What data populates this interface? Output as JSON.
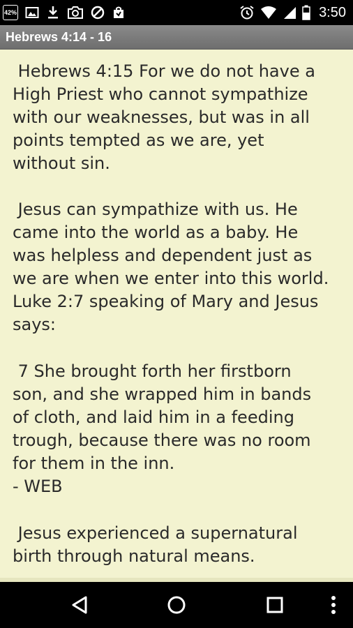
{
  "status_bar": {
    "battery_percent_icon_text": "42%",
    "time": "3:50",
    "left_icons": [
      "battery-percent-icon",
      "image-icon",
      "download-icon",
      "camera-icon",
      "block-icon",
      "store-icon"
    ],
    "right_icons": [
      "alarm-icon",
      "wifi-icon",
      "signal-icon",
      "battery-icon"
    ]
  },
  "header": {
    "title": "Hebrews 4:14 - 16"
  },
  "content": {
    "paragraphs": [
      " Hebrews 4:15 For we do not have a\nHigh Priest who cannot sympathize\nwith our weaknesses, but was in all\npoints tempted as we are, yet\nwithout sin.",
      " Jesus can sympathize with us. He\ncame into the world as a baby. He\nwas helpless and dependent just as\nwe are when we enter into this world.\nLuke 2:7 speaking of Mary and Jesus\nsays:",
      " 7 She brought forth her firstborn\nson, and she wrapped him in bands\nof cloth, and laid him in a feeding\ntrough, because there was no room\nfor them in the inn.\n- WEB",
      " Jesus experienced a supernatural\nbirth through natural means."
    ]
  },
  "nav_bar": {
    "buttons": [
      "back-icon",
      "home-icon",
      "recents-icon",
      "overflow-menu-icon"
    ]
  },
  "colors": {
    "content_background": "#f3f3d0",
    "title_bar": "#7d7d7d",
    "text": "#2a2a2a"
  }
}
